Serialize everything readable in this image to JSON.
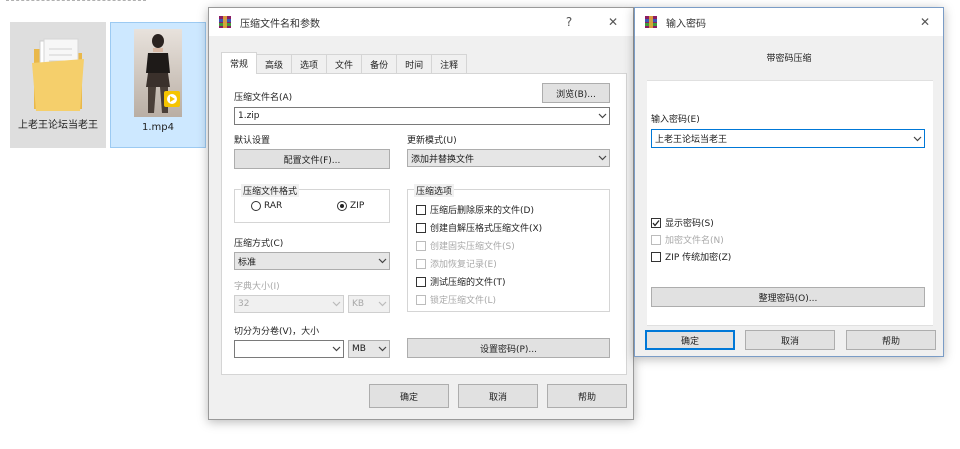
{
  "desktop": {
    "files": [
      {
        "name": "上老王论坛当老王",
        "kind": "folder"
      },
      {
        "name": "1.mp4",
        "kind": "video"
      }
    ]
  },
  "archive_dialog": {
    "title": "压缩文件名和参数",
    "help_glyph": "?",
    "close_glyph": "✕",
    "tabs": [
      "常规",
      "高级",
      "选项",
      "文件",
      "备份",
      "时间",
      "注释"
    ],
    "archive_name_label": "压缩文件名(A)",
    "browse_button": "浏览(B)...",
    "archive_name_value": "1.zip",
    "default_settings_label": "默认设置",
    "profiles_button": "配置文件(F)...",
    "update_mode_label": "更新模式(U)",
    "update_mode_value": "添加并替换文件",
    "format_group_label": "压缩文件格式",
    "format_options": [
      {
        "label": "RAR",
        "selected": false
      },
      {
        "label": "ZIP",
        "selected": true
      }
    ],
    "method_label": "压缩方式(C)",
    "method_value": "标准",
    "dict_size_label": "字典大小(I)",
    "dict_size_value": "32",
    "dict_unit_value": "KB",
    "split_label": "切分为分卷(V)，大小",
    "split_value": "",
    "split_unit_value": "MB",
    "options_group_label": "压缩选项",
    "options": [
      {
        "label": "压缩后删除原来的文件(D)",
        "checked": false,
        "disabled": false
      },
      {
        "label": "创建自解压格式压缩文件(X)",
        "checked": false,
        "disabled": false
      },
      {
        "label": "创建固实压缩文件(S)",
        "checked": false,
        "disabled": true
      },
      {
        "label": "添加恢复记录(E)",
        "checked": false,
        "disabled": true
      },
      {
        "label": "测试压缩的文件(T)",
        "checked": false,
        "disabled": false
      },
      {
        "label": "锁定压缩文件(L)",
        "checked": false,
        "disabled": true
      }
    ],
    "set_password_button": "设置密码(P)...",
    "ok_button": "确定",
    "cancel_button": "取消",
    "help_button": "帮助"
  },
  "password_dialog": {
    "title": "输入密码",
    "close_glyph": "✕",
    "heading": "带密码压缩",
    "enter_password_label": "输入密码(E)",
    "password_value": "上老王论坛当老王",
    "options": [
      {
        "label": "显示密码(S)",
        "checked": true,
        "disabled": false
      },
      {
        "label": "加密文件名(N)",
        "checked": false,
        "disabled": true
      },
      {
        "label": "ZIP 传统加密(Z)",
        "checked": false,
        "disabled": false
      }
    ],
    "organize_button": "整理密码(O)...",
    "ok_button": "确定",
    "cancel_button": "取消",
    "help_button": "帮助"
  },
  "colors": {
    "selection": "#cde8ff",
    "dialog_bg": "#f0f0f0",
    "focus_border": "#0078d7"
  }
}
